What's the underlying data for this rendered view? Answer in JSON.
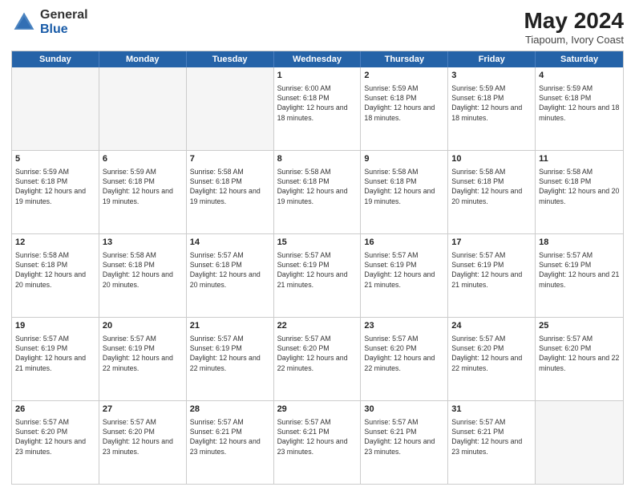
{
  "header": {
    "logo": {
      "general": "General",
      "blue": "Blue"
    },
    "title": "May 2024",
    "location": "Tiapoum, Ivory Coast"
  },
  "calendar": {
    "days_of_week": [
      "Sunday",
      "Monday",
      "Tuesday",
      "Wednesday",
      "Thursday",
      "Friday",
      "Saturday"
    ],
    "rows": [
      [
        {
          "day": "",
          "empty": true,
          "content": ""
        },
        {
          "day": "",
          "empty": true,
          "content": ""
        },
        {
          "day": "",
          "empty": true,
          "content": ""
        },
        {
          "day": "1",
          "content": "Sunrise: 6:00 AM\nSunset: 6:18 PM\nDaylight: 12 hours and 18 minutes."
        },
        {
          "day": "2",
          "content": "Sunrise: 5:59 AM\nSunset: 6:18 PM\nDaylight: 12 hours and 18 minutes."
        },
        {
          "day": "3",
          "content": "Sunrise: 5:59 AM\nSunset: 6:18 PM\nDaylight: 12 hours and 18 minutes."
        },
        {
          "day": "4",
          "content": "Sunrise: 5:59 AM\nSunset: 6:18 PM\nDaylight: 12 hours and 18 minutes."
        }
      ],
      [
        {
          "day": "5",
          "content": "Sunrise: 5:59 AM\nSunset: 6:18 PM\nDaylight: 12 hours and 19 minutes."
        },
        {
          "day": "6",
          "content": "Sunrise: 5:59 AM\nSunset: 6:18 PM\nDaylight: 12 hours and 19 minutes."
        },
        {
          "day": "7",
          "content": "Sunrise: 5:58 AM\nSunset: 6:18 PM\nDaylight: 12 hours and 19 minutes."
        },
        {
          "day": "8",
          "content": "Sunrise: 5:58 AM\nSunset: 6:18 PM\nDaylight: 12 hours and 19 minutes."
        },
        {
          "day": "9",
          "content": "Sunrise: 5:58 AM\nSunset: 6:18 PM\nDaylight: 12 hours and 19 minutes."
        },
        {
          "day": "10",
          "content": "Sunrise: 5:58 AM\nSunset: 6:18 PM\nDaylight: 12 hours and 20 minutes."
        },
        {
          "day": "11",
          "content": "Sunrise: 5:58 AM\nSunset: 6:18 PM\nDaylight: 12 hours and 20 minutes."
        }
      ],
      [
        {
          "day": "12",
          "content": "Sunrise: 5:58 AM\nSunset: 6:18 PM\nDaylight: 12 hours and 20 minutes."
        },
        {
          "day": "13",
          "content": "Sunrise: 5:58 AM\nSunset: 6:18 PM\nDaylight: 12 hours and 20 minutes."
        },
        {
          "day": "14",
          "content": "Sunrise: 5:57 AM\nSunset: 6:18 PM\nDaylight: 12 hours and 20 minutes."
        },
        {
          "day": "15",
          "content": "Sunrise: 5:57 AM\nSunset: 6:19 PM\nDaylight: 12 hours and 21 minutes."
        },
        {
          "day": "16",
          "content": "Sunrise: 5:57 AM\nSunset: 6:19 PM\nDaylight: 12 hours and 21 minutes."
        },
        {
          "day": "17",
          "content": "Sunrise: 5:57 AM\nSunset: 6:19 PM\nDaylight: 12 hours and 21 minutes."
        },
        {
          "day": "18",
          "content": "Sunrise: 5:57 AM\nSunset: 6:19 PM\nDaylight: 12 hours and 21 minutes."
        }
      ],
      [
        {
          "day": "19",
          "content": "Sunrise: 5:57 AM\nSunset: 6:19 PM\nDaylight: 12 hours and 21 minutes."
        },
        {
          "day": "20",
          "content": "Sunrise: 5:57 AM\nSunset: 6:19 PM\nDaylight: 12 hours and 22 minutes."
        },
        {
          "day": "21",
          "content": "Sunrise: 5:57 AM\nSunset: 6:19 PM\nDaylight: 12 hours and 22 minutes."
        },
        {
          "day": "22",
          "content": "Sunrise: 5:57 AM\nSunset: 6:20 PM\nDaylight: 12 hours and 22 minutes."
        },
        {
          "day": "23",
          "content": "Sunrise: 5:57 AM\nSunset: 6:20 PM\nDaylight: 12 hours and 22 minutes."
        },
        {
          "day": "24",
          "content": "Sunrise: 5:57 AM\nSunset: 6:20 PM\nDaylight: 12 hours and 22 minutes."
        },
        {
          "day": "25",
          "content": "Sunrise: 5:57 AM\nSunset: 6:20 PM\nDaylight: 12 hours and 22 minutes."
        }
      ],
      [
        {
          "day": "26",
          "content": "Sunrise: 5:57 AM\nSunset: 6:20 PM\nDaylight: 12 hours and 23 minutes."
        },
        {
          "day": "27",
          "content": "Sunrise: 5:57 AM\nSunset: 6:20 PM\nDaylight: 12 hours and 23 minutes."
        },
        {
          "day": "28",
          "content": "Sunrise: 5:57 AM\nSunset: 6:21 PM\nDaylight: 12 hours and 23 minutes."
        },
        {
          "day": "29",
          "content": "Sunrise: 5:57 AM\nSunset: 6:21 PM\nDaylight: 12 hours and 23 minutes."
        },
        {
          "day": "30",
          "content": "Sunrise: 5:57 AM\nSunset: 6:21 PM\nDaylight: 12 hours and 23 minutes."
        },
        {
          "day": "31",
          "content": "Sunrise: 5:57 AM\nSunset: 6:21 PM\nDaylight: 12 hours and 23 minutes."
        },
        {
          "day": "",
          "empty": true,
          "content": ""
        }
      ]
    ]
  }
}
